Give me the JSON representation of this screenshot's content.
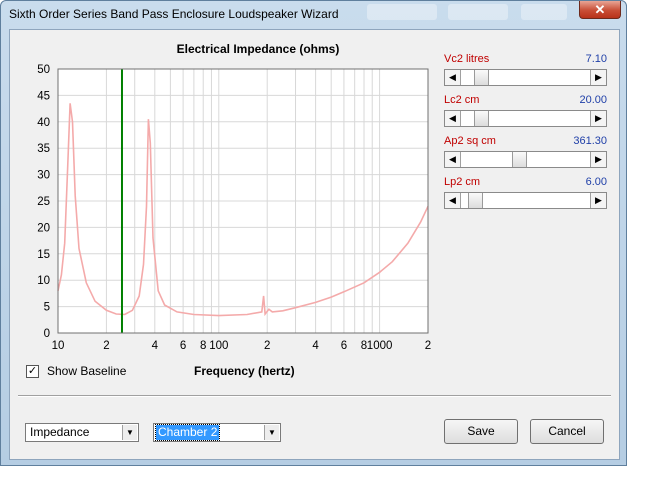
{
  "window": {
    "title": "Sixth Order Series Band Pass Enclosure Loudspeaker Wizard",
    "close_symbol": "✕"
  },
  "chart": {
    "title": "Electrical Impedance (ohms)",
    "xlabel": "Frequency (hertz)"
  },
  "chart_data": {
    "type": "line",
    "title": "Electrical Impedance (ohms)",
    "xlabel": "Frequency (hertz)",
    "ylabel": "",
    "xscale": "log",
    "xlim": [
      10,
      2000
    ],
    "ylim": [
      0,
      50
    ],
    "yticks": [
      0,
      5,
      10,
      15,
      20,
      25,
      30,
      35,
      40,
      45,
      50
    ],
    "xtick_labels": [
      {
        "x": 10,
        "label": "10"
      },
      {
        "x": 20,
        "label": "2"
      },
      {
        "x": 40,
        "label": "4"
      },
      {
        "x": 60,
        "label": "6"
      },
      {
        "x": 80,
        "label": "8"
      },
      {
        "x": 100,
        "label": "100"
      },
      {
        "x": 200,
        "label": "2"
      },
      {
        "x": 400,
        "label": "4"
      },
      {
        "x": 600,
        "label": "6"
      },
      {
        "x": 800,
        "label": "8"
      },
      {
        "x": 1000,
        "label": "1000"
      },
      {
        "x": 2000,
        "label": "2"
      }
    ],
    "grid": true,
    "marker_line": {
      "x": 25,
      "color": "#008000"
    },
    "series": [
      {
        "color": "#f4aaaa",
        "points": [
          [
            10,
            8
          ],
          [
            10.5,
            11
          ],
          [
            11,
            17
          ],
          [
            11.5,
            32
          ],
          [
            11.9,
            43.5
          ],
          [
            12.3,
            40
          ],
          [
            12.8,
            26
          ],
          [
            13.5,
            16
          ],
          [
            15,
            9.5
          ],
          [
            17,
            6
          ],
          [
            20,
            4.3
          ],
          [
            23,
            3.6
          ],
          [
            26,
            3.5
          ],
          [
            29,
            4.3
          ],
          [
            32,
            7
          ],
          [
            34,
            13
          ],
          [
            35.5,
            24
          ],
          [
            36.5,
            40.5
          ],
          [
            37.5,
            36
          ],
          [
            39,
            18
          ],
          [
            42,
            8
          ],
          [
            46,
            5.3
          ],
          [
            55,
            4.0
          ],
          [
            70,
            3.5
          ],
          [
            100,
            3.3
          ],
          [
            150,
            3.5
          ],
          [
            185,
            4.0
          ],
          [
            190,
            7
          ],
          [
            194,
            3.6
          ],
          [
            205,
            4.5
          ],
          [
            215,
            4.0
          ],
          [
            250,
            4.2
          ],
          [
            300,
            4.8
          ],
          [
            400,
            5.8
          ],
          [
            500,
            6.8
          ],
          [
            600,
            7.8
          ],
          [
            800,
            9.5
          ],
          [
            1000,
            11.5
          ],
          [
            1200,
            13.5
          ],
          [
            1500,
            17
          ],
          [
            1800,
            21
          ],
          [
            2000,
            24
          ]
        ]
      }
    ]
  },
  "params": [
    {
      "label": "Vc2  litres",
      "value": "7.10",
      "level": 0.12
    },
    {
      "label": "Lc2  cm",
      "value": "20.00",
      "level": 0.12
    },
    {
      "label": "Ap2  sq cm",
      "value": "361.30",
      "level": 0.45
    },
    {
      "label": "Lp2  cm",
      "value": "6.00",
      "level": 0.07
    }
  ],
  "baseline": {
    "checked": true,
    "check_mark": "✓",
    "label": "Show Baseline"
  },
  "selectors": {
    "graph_type": "Impedance",
    "chamber": "Chamber 2"
  },
  "buttons": {
    "save": "Save",
    "cancel": "Cancel"
  },
  "icons": {
    "scroll_left": "◀",
    "scroll_right": "▶",
    "dropdown": "▼"
  }
}
